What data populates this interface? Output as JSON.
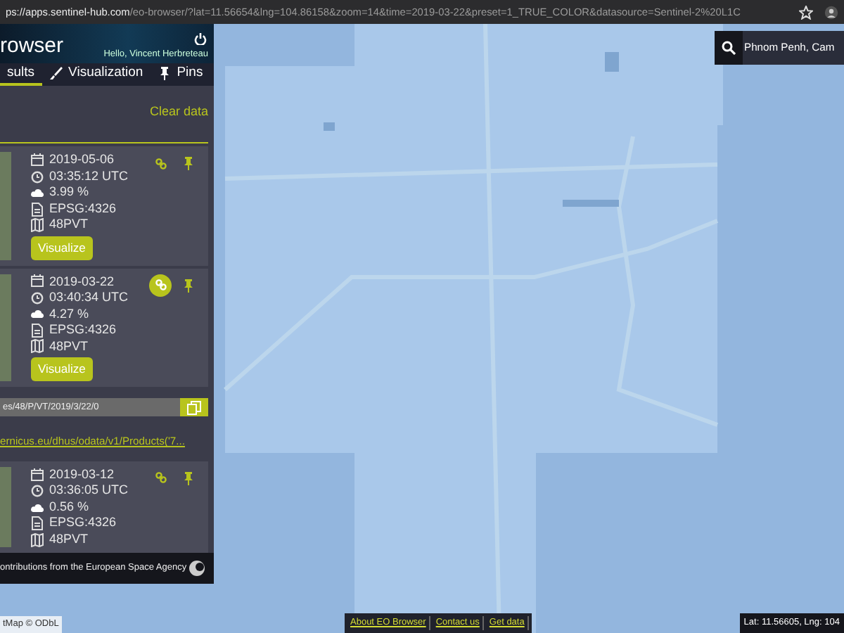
{
  "browser": {
    "url_host": "ps://apps.sentinel-hub.com",
    "url_path": "/eo-browser/?lat=11.56654&lng=104.86158&zoom=14&time=2019-03-22&preset=1_TRUE_COLOR&datasource=Sentinel-2%20L1C"
  },
  "panel": {
    "app_title": "rowser",
    "greeting": "Hello, Vincent Herbreteau",
    "tabs": [
      {
        "label": "sults",
        "selected": true
      },
      {
        "label": "Visualization",
        "selected": false
      },
      {
        "label": "Pins",
        "selected": false
      }
    ],
    "clear_label": "Clear data",
    "results": [
      {
        "date": "2019-05-06",
        "time": "03:35:12 UTC",
        "cloud": "3.99 %",
        "crs": "EPSG:4326",
        "tile": "48PVT",
        "link_active": false,
        "button": "Visualize"
      },
      {
        "date": "2019-03-22",
        "time": "03:40:34 UTC",
        "cloud": "4.27 %",
        "crs": "EPSG:4326",
        "tile": "48PVT",
        "link_active": true,
        "button": "Visualize",
        "copy_value": "es/48/P/VT/2019/3/22/0",
        "link": "ernicus.eu/dhus/odata/v1/Products('7..."
      },
      {
        "date": "2019-03-12",
        "time": "03:36:05 UTC",
        "cloud": "0.56 %",
        "crs": "EPSG:4326",
        "tile": "48PVT",
        "link_active": false
      }
    ],
    "footer": "ontributions from the European Space Agency"
  },
  "search": {
    "value": "Phnom Penh, Cam"
  },
  "attribution": "tMap © ODbL",
  "footer_links": [
    "About EO Browser",
    "Contact us",
    "Get data"
  ],
  "coordinates": "Lat: 11.56605, Lng: 104"
}
